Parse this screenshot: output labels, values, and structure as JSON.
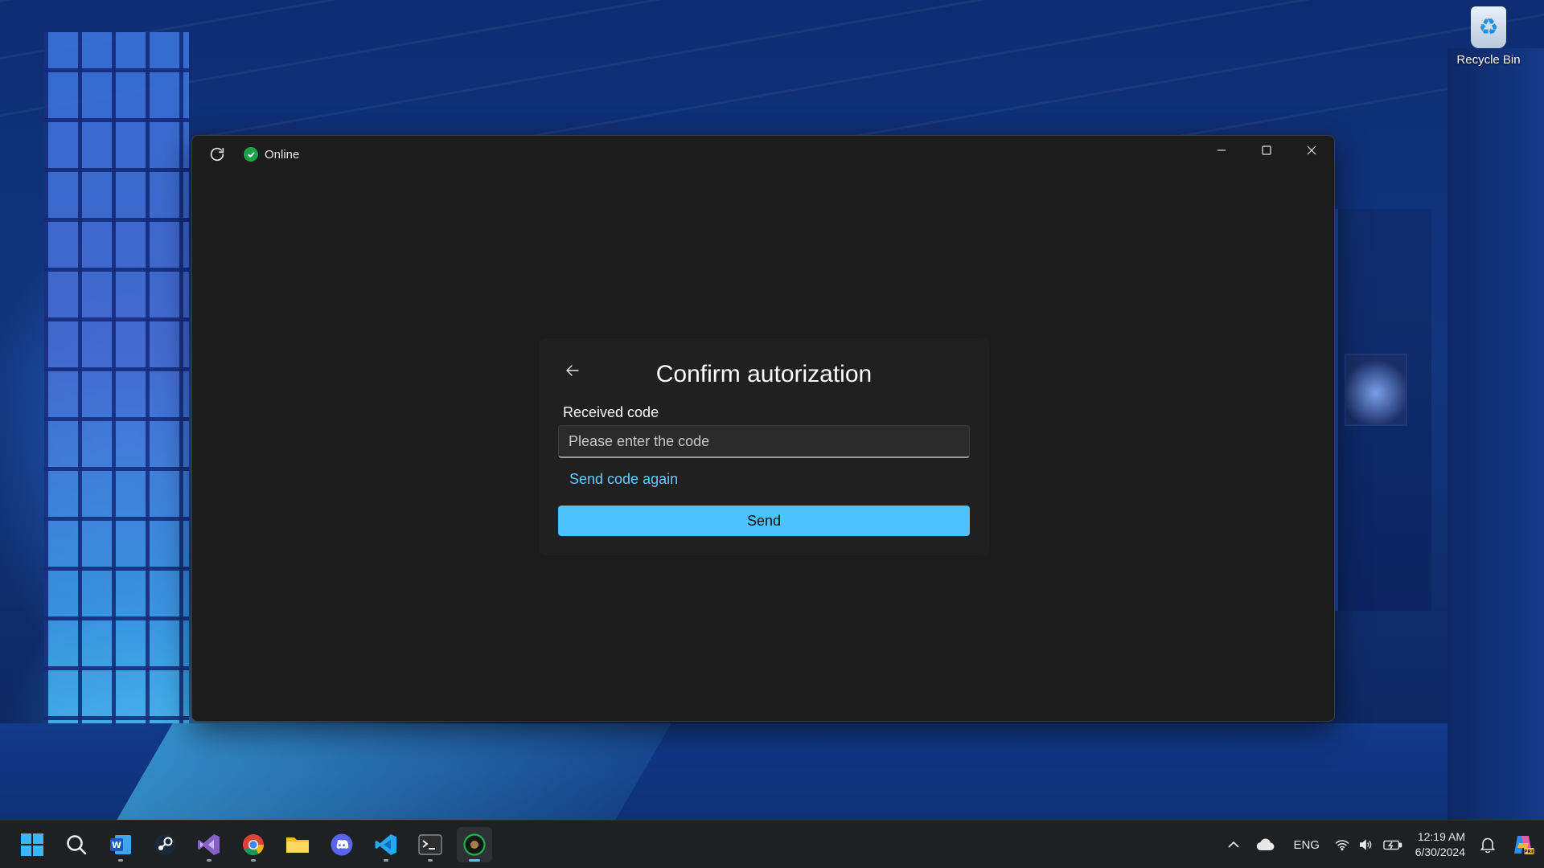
{
  "desktop": {
    "icons": [
      {
        "label": "Recycle Bin",
        "icon": "recycle-bin-icon"
      }
    ]
  },
  "window": {
    "status": {
      "text": "Online",
      "icon": "check-circle-icon",
      "color": "#16a34a"
    },
    "controls": {
      "minimize": "minimize-icon",
      "maximize": "maximize-icon",
      "close": "close-icon"
    }
  },
  "auth": {
    "title": "Confirm autorization",
    "code_label": "Received code",
    "code_value": "",
    "code_placeholder": "Please enter the code",
    "resend_label": "Send code again",
    "send_label": "Send",
    "accent": "#4cc2ff",
    "link_color": "#60cdff"
  },
  "taskbar": {
    "apps": [
      {
        "name": "start-icon",
        "running": false,
        "active": false
      },
      {
        "name": "search-icon",
        "running": false,
        "active": false
      },
      {
        "name": "word-icon",
        "running": true,
        "active": false
      },
      {
        "name": "steam-icon",
        "running": false,
        "active": false
      },
      {
        "name": "visual-studio-icon",
        "running": true,
        "active": false
      },
      {
        "name": "chrome-icon",
        "running": true,
        "active": false
      },
      {
        "name": "file-explorer-icon",
        "running": false,
        "active": false
      },
      {
        "name": "discord-icon",
        "running": false,
        "active": false
      },
      {
        "name": "vscode-icon",
        "running": true,
        "active": false
      },
      {
        "name": "terminal-icon",
        "running": true,
        "active": false
      },
      {
        "name": "current-app-icon",
        "running": true,
        "active": true
      }
    ],
    "tray": {
      "language": "ENG",
      "time": "12:19 AM",
      "date": "6/30/2024"
    }
  }
}
